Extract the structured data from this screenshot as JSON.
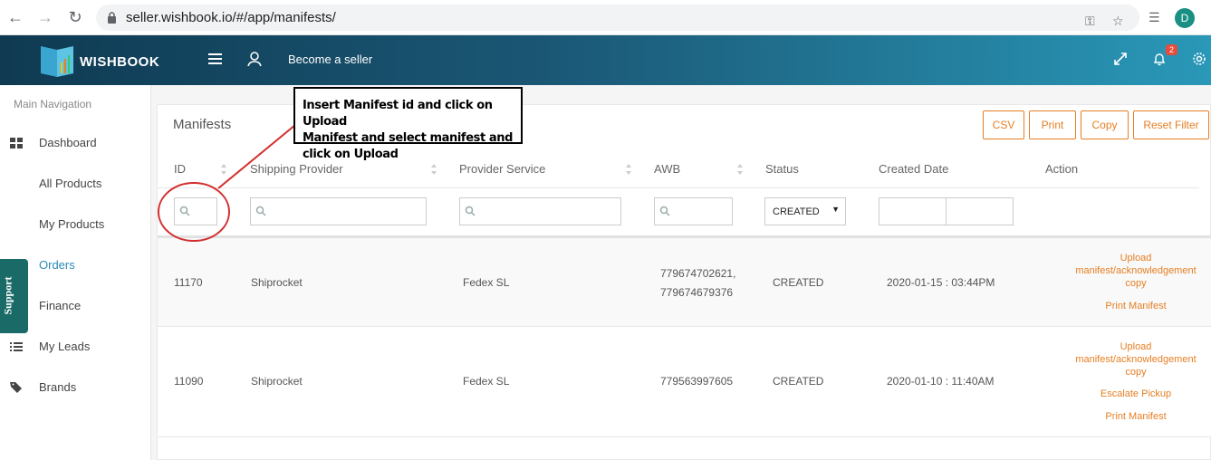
{
  "browser": {
    "url": "seller.wishbook.io/#/app/manifests/",
    "avatar_letter": "D"
  },
  "header": {
    "logo_text": "WISHBOOK",
    "become_seller": "Become a seller",
    "notification_count": "2",
    "gradient": [
      "#0f3a52",
      "#2a98b8"
    ]
  },
  "sidebar": {
    "title": "Main Navigation",
    "support": "Support",
    "items": [
      {
        "label": "Dashboard",
        "icon": "dashboard-icon"
      },
      {
        "label": "All Products",
        "icon": ""
      },
      {
        "label": "My Products",
        "icon": ""
      },
      {
        "label": "Orders",
        "icon": "cart-icon",
        "active": true
      },
      {
        "label": "Finance",
        "icon": "file-icon"
      },
      {
        "label": "My Leads",
        "icon": "list-icon"
      },
      {
        "label": "Brands",
        "icon": "tags-icon"
      }
    ]
  },
  "panel": {
    "title": "Manifests",
    "buttons": {
      "csv": "CSV",
      "print": "Print",
      "copy": "Copy",
      "reset": "Reset Filter"
    },
    "accent": "#e67e22"
  },
  "table": {
    "headers": [
      "ID",
      "Shipping Provider",
      "Provider Service",
      "AWB",
      "Status",
      "Created Date",
      "Action"
    ],
    "status_filter": "CREATED",
    "rows": [
      {
        "id": "11170",
        "provider": "Shiprocket",
        "service": "Fedex SL",
        "awb_line1": "779674702621,",
        "awb_line2": "779674679376",
        "status": "CREATED",
        "date": "2020-01-15 : 03:44PM",
        "actions": [
          "Upload",
          "manifest/acknowledgement",
          "copy",
          "Print Manifest"
        ]
      },
      {
        "id": "11090",
        "provider": "Shiprocket",
        "service": "Fedex SL",
        "awb_line1": "779563997605",
        "status": "CREATED",
        "date": "2020-01-10 : 11:40AM",
        "actions": [
          "Upload",
          "manifest/acknowledgement",
          "copy",
          "Escalate Pickup",
          "Print Manifest"
        ]
      }
    ]
  },
  "annotation": {
    "line1": "Insert Manifest id and click on Upload",
    "line2": "Manifest and select manifest and",
    "line3": "click on Upload"
  }
}
